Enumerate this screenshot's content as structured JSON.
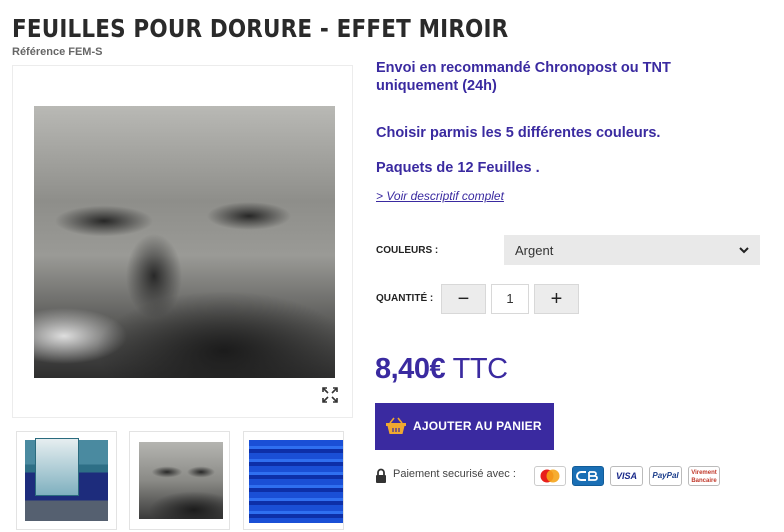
{
  "product": {
    "title": "FEUILLES POUR DORURE - EFFET MIROIR",
    "reference": "Référence FEM-S"
  },
  "info": {
    "shipping": "Envoi en recommandé Chronopost ou TNT uniquement (24h)",
    "choose_colors": "Choisir parmis les 5 différentes couleurs.",
    "pack": "Paquets de 12 Feuilles .",
    "description_link": "> Voir descriptif complet"
  },
  "options": {
    "color_label": "COULEURS :",
    "color_value": "Argent",
    "quantity_label": "QUANTITÉ :",
    "minus_label": "−",
    "plus_label": "+",
    "quantity_value": "1"
  },
  "purchase": {
    "price": "8,40€",
    "price_suffix": "TTC",
    "add_to_cart": "AJOUTER AU PANIER",
    "secure_text": "Paiement securisé avec :"
  },
  "payment_methods": {
    "visa": "VISA",
    "paypal": "PayPal",
    "virement": "Virement Bancaire"
  },
  "icons": [
    "expand-icon",
    "chevron-down-icon",
    "basket-icon",
    "lock-icon",
    "mastercard-icon",
    "cb-icon",
    "visa-icon",
    "paypal-icon",
    "bank-transfer-icon"
  ],
  "colors": {
    "accent": "#3a2aa0",
    "select_bg": "#e9e9e9"
  }
}
